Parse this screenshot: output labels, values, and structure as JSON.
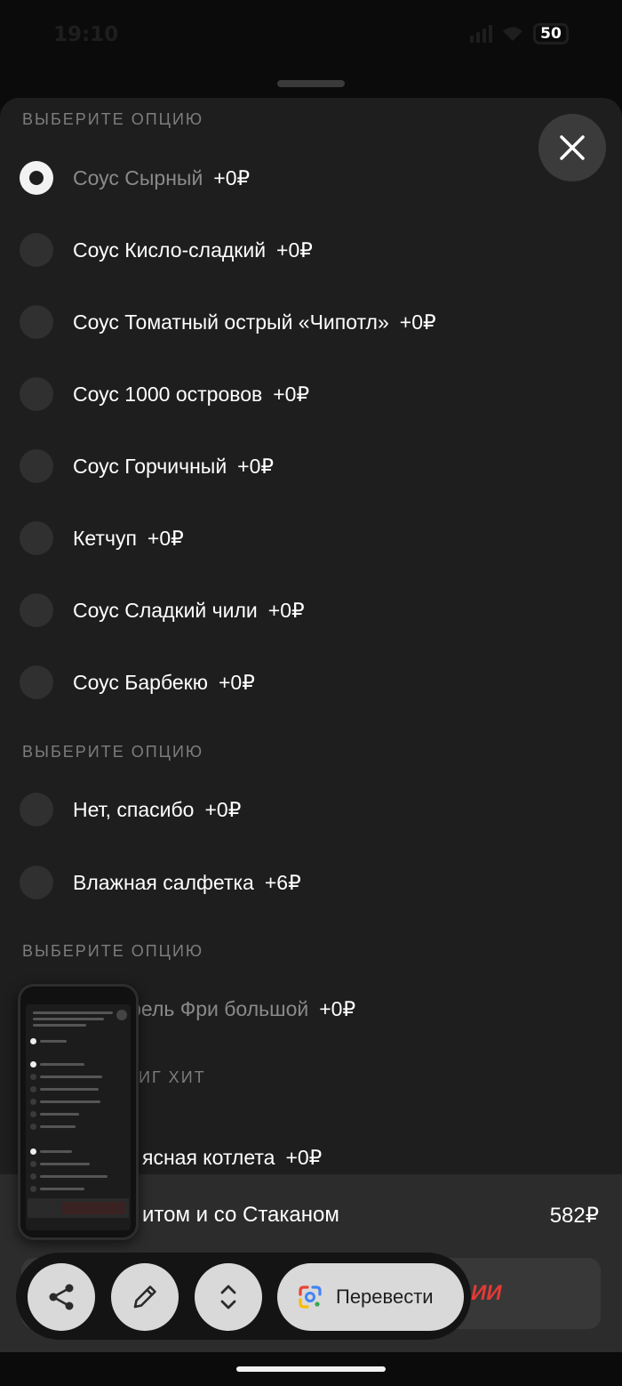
{
  "status_bar": {
    "time": "19:10",
    "battery": "50"
  },
  "sheet": {
    "sections": [
      {
        "title": "ВЫБЕРИТЕ ОПЦИЮ",
        "options": [
          {
            "label": "Соус Сырный",
            "price": "+0₽",
            "selected": true
          },
          {
            "label": "Соус Кисло-сладкий",
            "price": "+0₽",
            "selected": false
          },
          {
            "label": "Соус Томатный острый «Чипотл»",
            "price": "+0₽",
            "selected": false
          },
          {
            "label": "Соус 1000 островов",
            "price": "+0₽",
            "selected": false
          },
          {
            "label": "Соус Горчичный",
            "price": "+0₽",
            "selected": false
          },
          {
            "label": "Кетчуп",
            "price": "+0₽",
            "selected": false
          },
          {
            "label": "Соус Сладкий чили",
            "price": "+0₽",
            "selected": false
          },
          {
            "label": "Соус Барбекю",
            "price": "+0₽",
            "selected": false
          }
        ]
      },
      {
        "title": "ВЫБЕРИТЕ ОПЦИЮ",
        "options": [
          {
            "label": "Нет, спасибо",
            "price": "+0₽",
            "selected": false
          },
          {
            "label": "Влажная салфетка",
            "price": "+6₽",
            "selected": false
          }
        ]
      },
      {
        "title": "ВЫБЕРИТЕ ОПЦИЮ",
        "options": [
          {
            "label": "фель Фри большой",
            "price": "+0₽",
            "selected": false
          }
        ]
      },
      {
        "title": "ИГ ХИТ",
        "options": [
          {
            "label": "ясная котлета",
            "price": "+0₽",
            "selected": false
          }
        ]
      }
    ]
  },
  "summary": {
    "name": "итом и со Стаканом",
    "price": "582₽",
    "add_label": "ИИ"
  },
  "toolbar": {
    "translate_label": "Перевести"
  },
  "icons": {
    "close": "close-icon",
    "share": "share-icon",
    "edit": "pencil-icon",
    "expand": "expand-icon",
    "translate": "google-lens-icon"
  }
}
